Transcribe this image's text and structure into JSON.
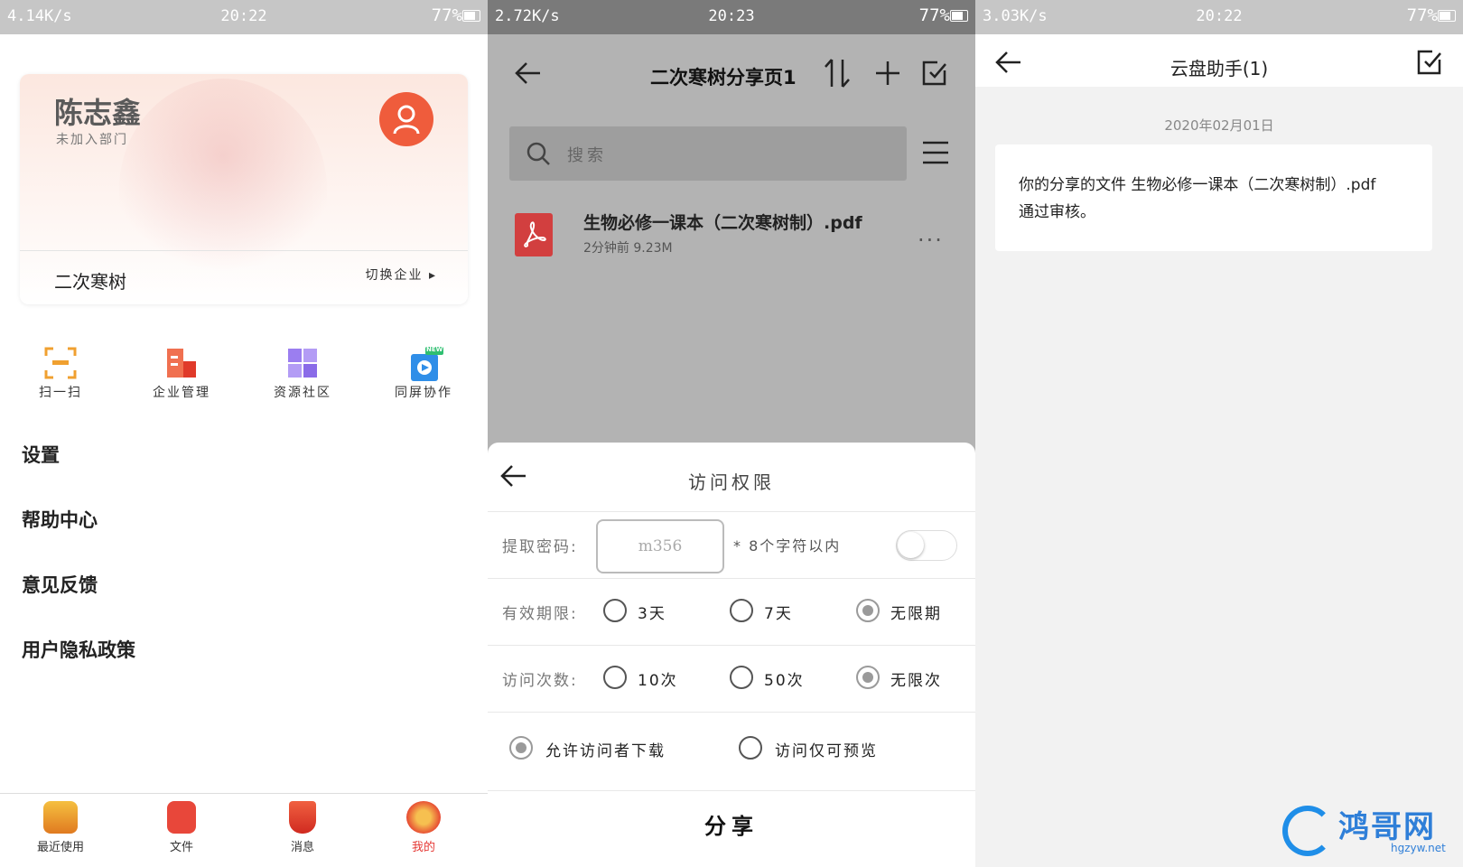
{
  "screen_left": {
    "status": {
      "net": "4.14K/s",
      "time": "20:22",
      "battery": "77%"
    },
    "user": {
      "name": "陈志鑫",
      "dept": "未加入部门"
    },
    "company": {
      "name": "二次寒树",
      "switch_label": "切换企业"
    },
    "tools": [
      {
        "label": "扫一扫",
        "icon": "scan-icon"
      },
      {
        "label": "企业管理",
        "icon": "enterprise-icon"
      },
      {
        "label": "资源社区",
        "icon": "community-icon"
      },
      {
        "label": "同屏协作",
        "icon": "screen-collab-icon",
        "badge": "NEW"
      }
    ],
    "menu": [
      "设置",
      "帮助中心",
      "意见反馈",
      "用户隐私政策"
    ],
    "tabs": [
      {
        "label": "最近使用",
        "icon": "recent-icon"
      },
      {
        "label": "文件",
        "icon": "file-icon"
      },
      {
        "label": "消息",
        "icon": "message-icon"
      },
      {
        "label": "我的",
        "icon": "mine-icon",
        "active": true
      }
    ],
    "colors": {
      "accent": "#ef5c3c",
      "active_tab": "#e53935"
    }
  },
  "screen_middle": {
    "status": {
      "net": "2.72K/s",
      "time": "20:23",
      "battery": "77%"
    },
    "title": "二次寒树分享页1",
    "search_placeholder": "搜索",
    "file": {
      "name": "生物必修一课本（二次寒树制）.pdf",
      "meta": "2分钟前 9.23M"
    },
    "sheet": {
      "title": "访问权限",
      "password_label": "提取密码:",
      "password_value": "m356",
      "password_note": "* 8个字符以内",
      "validity_label": "有效期限:",
      "validity_options": [
        "3天",
        "7天",
        "无限期"
      ],
      "validity_selected": "无限期",
      "count_label": "访问次数:",
      "count_options": [
        "10次",
        "50次",
        "无限次"
      ],
      "count_selected": "无限次",
      "download_option": "允许访问者下载",
      "preview_option": "访问仅可预览",
      "share_button": "分享"
    }
  },
  "screen_right": {
    "status": {
      "net": "3.03K/s",
      "time": "20:22",
      "battery": "77%"
    },
    "title": "云盘助手(1)",
    "date": "2020年02月01日",
    "message": "你的分享的文件 生物必修一课本（二次寒树制）.pdf 通过审核。",
    "watermark": {
      "cn": "鸿哥网",
      "en": "hgzyw.net"
    }
  }
}
